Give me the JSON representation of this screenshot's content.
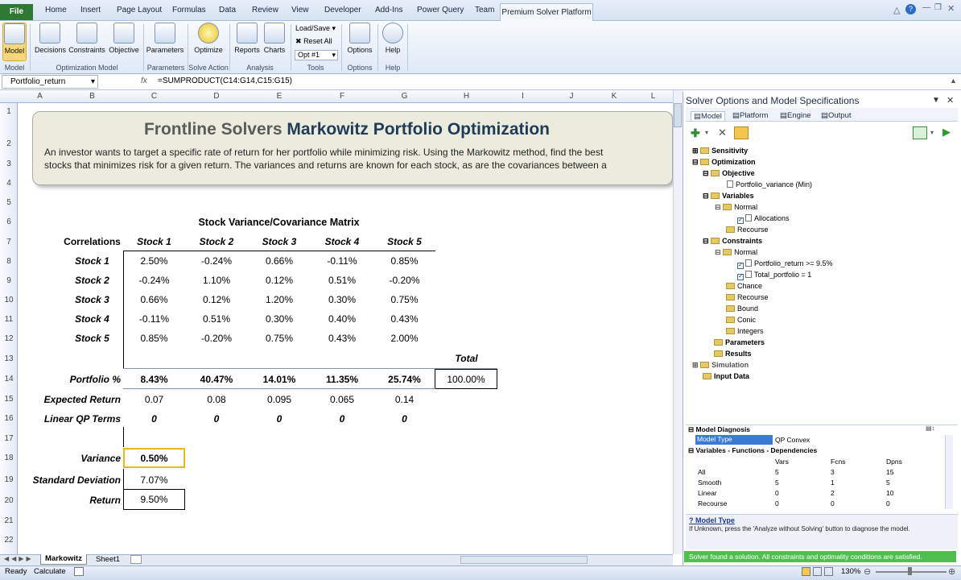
{
  "ribbon": {
    "file_tab": "File",
    "tabs": [
      "Home",
      "Insert",
      "Page Layout",
      "Formulas",
      "Data",
      "Review",
      "View",
      "Developer",
      "Add-Ins",
      "Power Query",
      "Team"
    ],
    "active_tab": "Premium Solver Platform",
    "buttons": {
      "model": "Model",
      "decisions": "Decisions",
      "constraints": "Constraints",
      "objective": "Objective",
      "parameters": "Parameters",
      "optimize": "Optimize",
      "reports": "Reports",
      "charts": "Charts",
      "load_save": "Load/Save",
      "reset_all": "Reset All",
      "opt_select": "Opt #1",
      "options": "Options",
      "help": "Help"
    },
    "groups": {
      "model": "Model",
      "optimization_model": "Optimization Model",
      "parameters": "Parameters",
      "solve_action": "Solve Action",
      "analysis": "Analysis",
      "tools": "Tools",
      "options": "Options",
      "help": "Help"
    }
  },
  "formula_bar": {
    "name_box": "Portfolio_return",
    "fx": "fx",
    "formula": "=SUMPRODUCT(C14:G14,C15:G15)"
  },
  "columns": [
    "A",
    "B",
    "C",
    "D",
    "E",
    "F",
    "G",
    "H",
    "I",
    "J",
    "K",
    "L"
  ],
  "rows": [
    "1",
    "2",
    "3",
    "4",
    "5",
    "6",
    "7",
    "8",
    "9",
    "10",
    "11",
    "12",
    "13",
    "14",
    "15",
    "16",
    "17",
    "18",
    "19",
    "20",
    "21",
    "22"
  ],
  "banner": {
    "title_a": "Frontline Solvers ",
    "title_b": "Markowitz Portfolio Optimization",
    "line1": "An investor wants to target a specific rate of return for her portfolio while minimizing risk. Using the Markowitz method, find the best",
    "line2": "stocks that minimizes risk for a given return. The variances and returns are known for each stock, as are the covariances between a"
  },
  "matrix": {
    "title": "Stock Variance/Covariance Matrix",
    "corner": "Correlations",
    "headers": [
      "Stock 1",
      "Stock 2",
      "Stock 3",
      "Stock 4",
      "Stock 5"
    ],
    "rows": [
      {
        "label": "Stock 1",
        "values": [
          "2.50%",
          "-0.24%",
          "0.66%",
          "-0.11%",
          "0.85%"
        ]
      },
      {
        "label": "Stock 2",
        "values": [
          "-0.24%",
          "1.10%",
          "0.12%",
          "0.51%",
          "-0.20%"
        ]
      },
      {
        "label": "Stock 3",
        "values": [
          "0.66%",
          "0.12%",
          "1.20%",
          "0.30%",
          "0.75%"
        ]
      },
      {
        "label": "Stock 4",
        "values": [
          "-0.11%",
          "0.51%",
          "0.30%",
          "0.40%",
          "0.43%"
        ]
      },
      {
        "label": "Stock 5",
        "values": [
          "0.85%",
          "-0.20%",
          "0.75%",
          "0.43%",
          "2.00%"
        ]
      }
    ]
  },
  "portfolio": {
    "total_label": "Total",
    "portfolio_label": "Portfolio %",
    "portfolio_values": [
      "8.43%",
      "40.47%",
      "14.01%",
      "11.35%",
      "25.74%"
    ],
    "total": "100.00%",
    "expected_label": "Expected Return",
    "expected_values": [
      "0.07",
      "0.08",
      "0.095",
      "0.065",
      "0.14"
    ],
    "qp_label": "Linear QP Terms",
    "qp_values": [
      "0",
      "0",
      "0",
      "0",
      "0"
    ],
    "variance_label": "Variance",
    "variance": "0.50%",
    "stdev_label": "Standard Deviation",
    "stdev": "7.07%",
    "return_label": "Return",
    "return": "9.50%"
  },
  "sheet_tabs": [
    "Markowitz",
    "Sheet1"
  ],
  "status": {
    "ready": "Ready",
    "calculate": "Calculate",
    "zoom": "130%"
  },
  "pane": {
    "title": "Solver Options and Model Specifications",
    "tabs": [
      "Model",
      "Platform",
      "Engine",
      "Output"
    ],
    "tree": {
      "sensitivity": "Sensitivity",
      "optimization": "Optimization",
      "objective": "Objective",
      "objective_item": "Portfolio_variance (Min)",
      "variables": "Variables",
      "normal": "Normal",
      "allocations": "Allocations",
      "recourse": "Recourse",
      "constraints": "Constraints",
      "c_normal": "Normal",
      "c1": "Portfolio_return >= 9.5%",
      "c2": "Total_portfolio = 1",
      "chance": "Chance",
      "c_recourse": "Recourse",
      "bound": "Bound",
      "conic": "Conic",
      "integers": "Integers",
      "parameters": "Parameters",
      "results": "Results",
      "simulation": "Simulation",
      "input_data": "Input Data"
    },
    "diagnosis": {
      "header": "Model Diagnosis",
      "model_type_label": "Model Type",
      "model_type": "QP Convex",
      "deps_header": "Variables - Functions - Dependencies",
      "cols": [
        "Vars",
        "Fcns",
        "Dpns"
      ],
      "rows": [
        [
          "All",
          "5",
          "3",
          "15"
        ],
        [
          "Smooth",
          "5",
          "1",
          "5"
        ],
        [
          "Linear",
          "0",
          "2",
          "10"
        ],
        [
          "Recourse",
          "0",
          "0",
          "0"
        ]
      ]
    },
    "help_title": "Model Type",
    "help_text": "If Unknown, press the 'Analyze without Solving' button to diagnose the model.",
    "solver_message": "Solver found a solution.  All constraints and optimality conditions are satisfied."
  },
  "colors": {
    "file_tab": "#2f7a33",
    "title_dark": "#1f3b58",
    "success": "#4fc04f",
    "variance_border": "#e7b91c"
  }
}
